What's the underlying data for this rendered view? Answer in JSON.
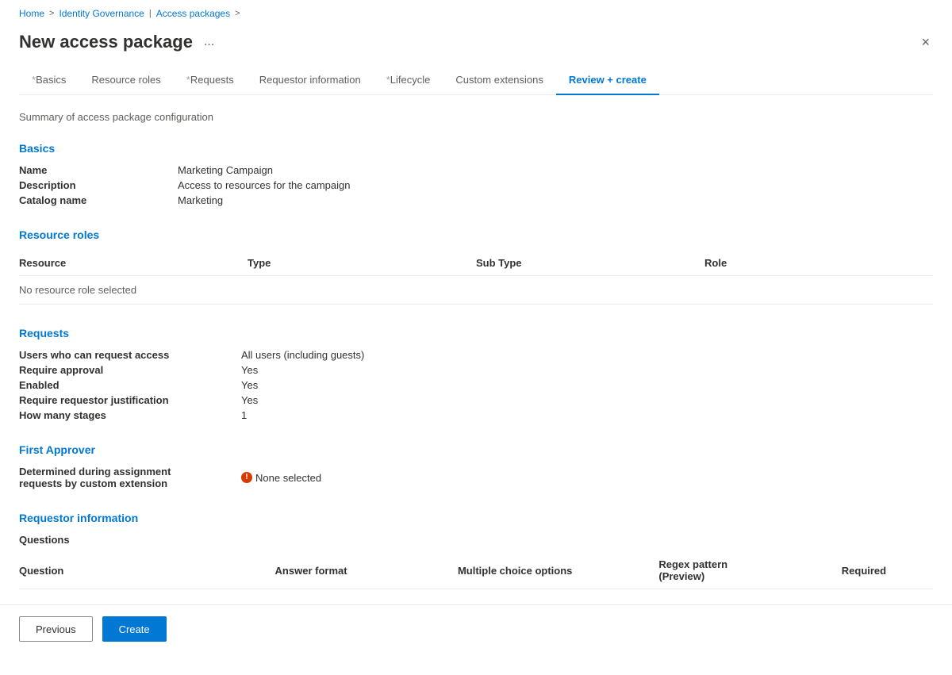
{
  "breadcrumb": {
    "home": "Home",
    "identity_governance": "Identity Governance",
    "separator": ">",
    "access_packages": "Access packages"
  },
  "page": {
    "title": "New access package",
    "more_label": "...",
    "summary_subtitle": "Summary of access package configuration"
  },
  "tabs": [
    {
      "id": "basics",
      "label": "Basics",
      "prefix": "*",
      "active": false
    },
    {
      "id": "resource-roles",
      "label": "Resource roles",
      "prefix": "",
      "active": false
    },
    {
      "id": "requests",
      "label": "Requests",
      "prefix": "*",
      "active": false
    },
    {
      "id": "requestor-information",
      "label": "Requestor information",
      "prefix": "",
      "active": false
    },
    {
      "id": "lifecycle",
      "label": "Lifecycle",
      "prefix": "*",
      "active": false
    },
    {
      "id": "custom-extensions",
      "label": "Custom extensions",
      "prefix": "",
      "active": false
    },
    {
      "id": "review-create",
      "label": "Review + create",
      "prefix": "",
      "active": true
    }
  ],
  "basics": {
    "heading": "Basics",
    "fields": [
      {
        "label": "Name",
        "value": "Marketing Campaign"
      },
      {
        "label": "Description",
        "value": "Access to resources for the campaign"
      },
      {
        "label": "Catalog name",
        "value": "Marketing"
      }
    ]
  },
  "resource_roles": {
    "heading": "Resource roles",
    "columns": [
      "Resource",
      "Type",
      "Sub Type",
      "Role"
    ],
    "empty_message": "No resource role selected"
  },
  "requests": {
    "heading": "Requests",
    "fields": [
      {
        "label": "Users who can request access",
        "value": "All users (including guests)"
      },
      {
        "label": "Require approval",
        "value": "Yes"
      },
      {
        "label": "Enabled",
        "value": "Yes"
      },
      {
        "label": "Require requestor justification",
        "value": "Yes"
      },
      {
        "label": "How many stages",
        "value": "1"
      }
    ]
  },
  "first_approver": {
    "heading": "First Approver",
    "label": "Determined during assignment requests by custom extension",
    "value": "None selected",
    "warning": true
  },
  "requestor_information": {
    "heading": "Requestor information",
    "questions_label": "Questions",
    "columns": [
      "Question",
      "Answer format",
      "Multiple choice options",
      "Regex pattern (Preview)",
      "Required"
    ]
  },
  "buttons": {
    "previous": "Previous",
    "create": "Create"
  },
  "icons": {
    "close": "×",
    "more": "···",
    "warning": "!"
  }
}
